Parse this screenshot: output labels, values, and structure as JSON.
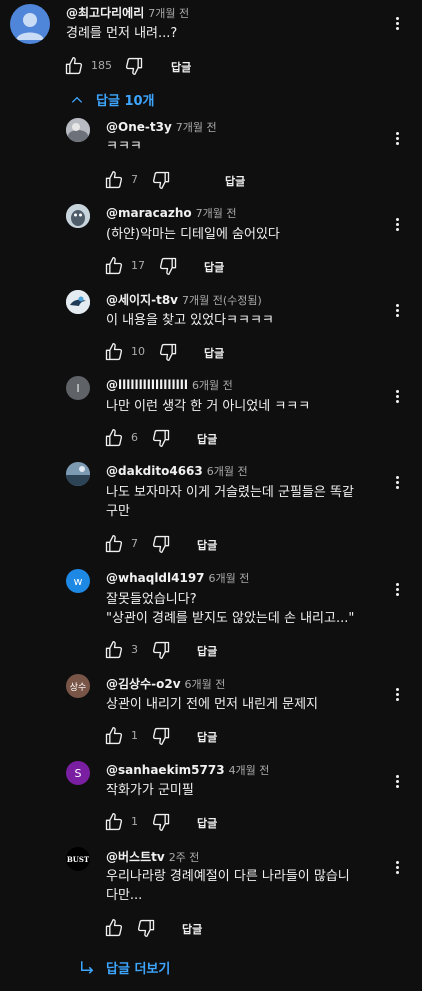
{
  "top_comment": {
    "author": "@최고다리에리",
    "time": "7개월 전",
    "text": "경례를 먼저 내려...?",
    "likes": "185",
    "reply_label": "답글"
  },
  "replies_toggle": {
    "label": "답글 10개",
    "icon": "chevron-up-icon"
  },
  "replies": [
    {
      "author": "@One-t3y",
      "time": "7개월 전",
      "lines": [
        "ㅋㅋㅋ"
      ],
      "likes": "7",
      "reply_label": "답글",
      "avatar_color": "#8a8f98",
      "avatar_text": ""
    },
    {
      "author": "@maracazho",
      "time": "7개월 전",
      "lines": [
        "(하얀)악마는 디테일에 숨어있다"
      ],
      "likes": "17",
      "reply_label": "답글",
      "avatar_color": "#b7c3cc",
      "avatar_text": ""
    },
    {
      "author": "@세이지-t8v",
      "time": "7개월 전(수정됨)",
      "lines": [
        "이 내용을 찾고 있었다ㅋㅋㅋㅋ"
      ],
      "likes": "10",
      "reply_label": "답글",
      "avatar_color": "#d9e3ea",
      "avatar_text": ""
    },
    {
      "author": "@lllllllllllllllll",
      "time": "6개월 전",
      "lines": [
        "나만 이런 생각 한 거 아니었네 ㅋㅋㅋ"
      ],
      "likes": "6",
      "reply_label": "답글",
      "avatar_color": "#5f6368",
      "avatar_text": "l"
    },
    {
      "author": "@dakdito4663",
      "time": "6개월 전",
      "lines": [
        "나도 보자마자 이게 거슬렸는데 군필들은 똑같",
        "구만"
      ],
      "likes": "7",
      "reply_label": "답글",
      "avatar_color": "#3d5a73",
      "avatar_text": ""
    },
    {
      "author": "@whaqldl4197",
      "time": "6개월 전",
      "lines": [
        "잘못들었습니다?",
        "\"상관이 경례를 받지도 않았는데 손 내리고...\""
      ],
      "likes": "3",
      "reply_label": "답글",
      "avatar_color": "#1e88e5",
      "avatar_text": "w"
    },
    {
      "author": "@김상수-o2v",
      "time": "6개월 전",
      "lines": [
        "상관이 내리기 전에  먼저 내린게 문제지"
      ],
      "likes": "1",
      "reply_label": "답글",
      "avatar_color": "#795548",
      "avatar_text": "상수"
    },
    {
      "author": "@sanhaekim5773",
      "time": "4개월 전",
      "lines": [
        "작화가가 군미필"
      ],
      "likes": "1",
      "reply_label": "답글",
      "avatar_color": "#7b1fa2",
      "avatar_text": "S"
    },
    {
      "author": "@버스트tv",
      "time": "2주 전",
      "lines": [
        "우리나라랑 경례예절이 다른 나라들이 많습니",
        "다만..."
      ],
      "likes": "",
      "reply_label": "답글",
      "avatar_color": "#000000",
      "avatar_text": "BUST"
    }
  ],
  "more_replies": {
    "label": "답글 더보기",
    "icon": "reply-arrow-icon"
  }
}
